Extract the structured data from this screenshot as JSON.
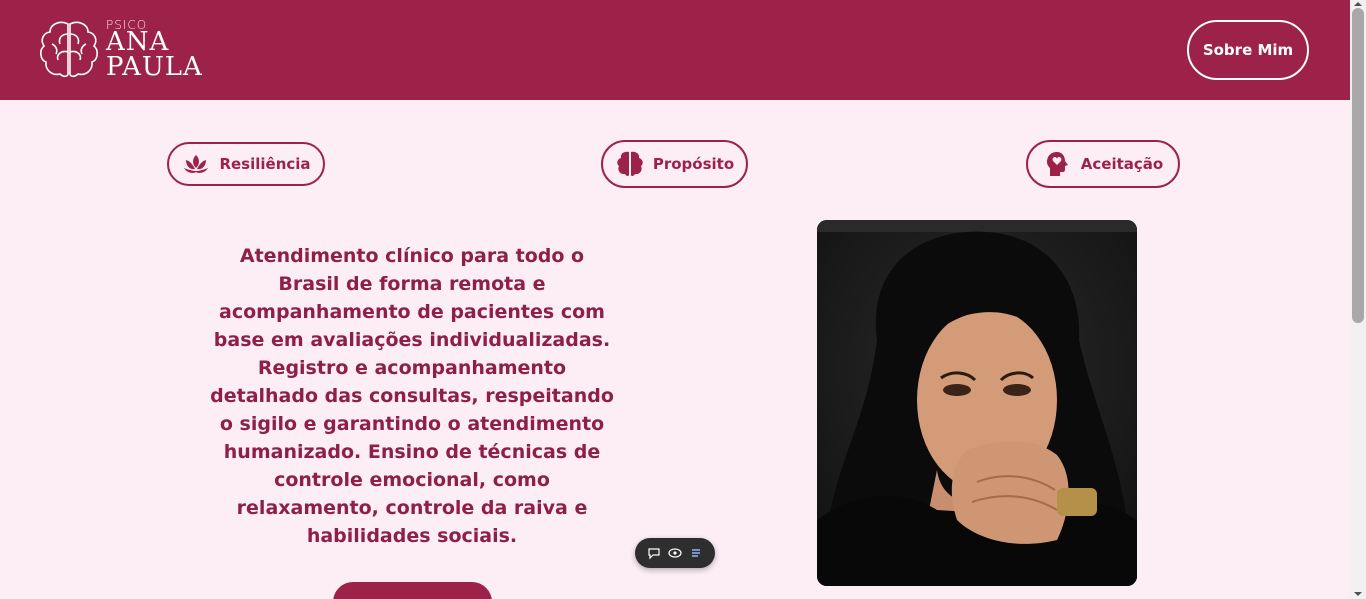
{
  "header": {
    "logo": {
      "small": "PSICO",
      "line1": "ANA",
      "line2": "PAULA"
    },
    "nav_button": "Sobre Mim",
    "bg_color": "#9c2249"
  },
  "values": [
    {
      "label": "Resiliência",
      "icon": "lotus-icon"
    },
    {
      "label": "Propósito",
      "icon": "brain-icon"
    },
    {
      "label": "Aceitação",
      "icon": "head-heart-icon"
    }
  ],
  "main": {
    "description": "Atendimento clínico para todo o Brasil de forma remota e acompanhamento de pacientes com base em avaliações individualizadas. Registro e acompanhamento detalhado das consultas, respeitando o sigilo e garantindo o atendimento humanizado. Ensino de técnicas de controle emocional, como relaxamento, controle da raiva e habilidades sociais.",
    "photo_alt": "photo-portrait",
    "cta_color": "#9c2249"
  },
  "toolbar": {
    "items": [
      "comment-icon",
      "eye-icon",
      "list-icon"
    ]
  },
  "colors": {
    "accent": "#9c2249",
    "background": "#fdeef6",
    "text": "#8e1f49"
  }
}
